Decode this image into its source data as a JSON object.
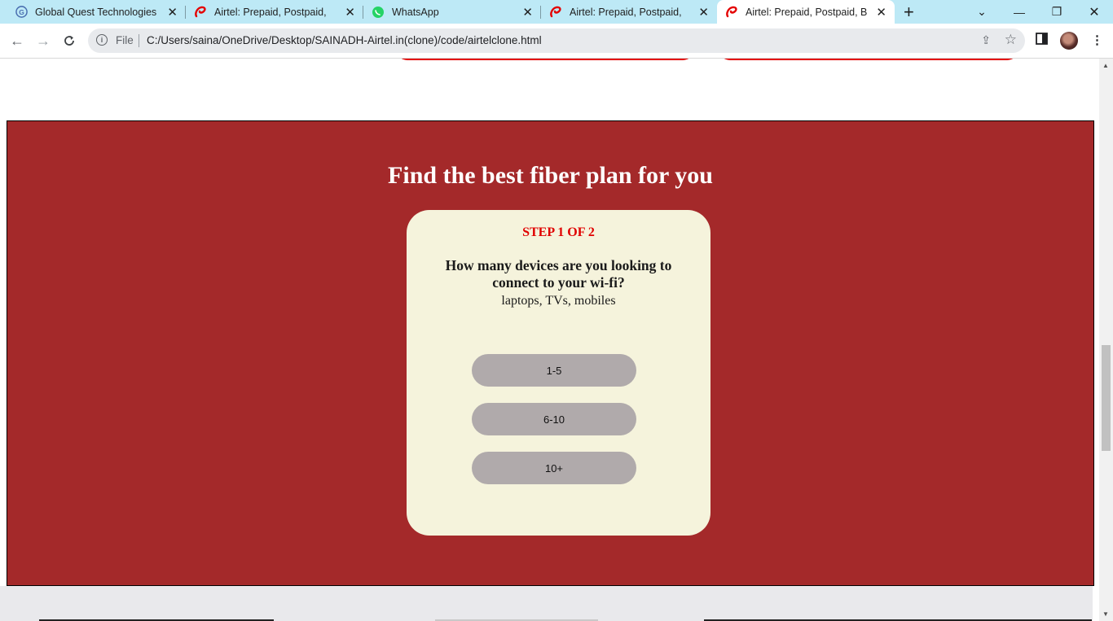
{
  "browser": {
    "tabs": [
      {
        "title": "Global Quest Technologies",
        "favicon": "globe-g-icon"
      },
      {
        "title": "Airtel: Prepaid, Postpaid, Bro",
        "favicon": "airtel-logo-icon"
      },
      {
        "title": "WhatsApp",
        "favicon": "whatsapp-icon"
      },
      {
        "title": "Airtel: Prepaid, Postpaid, Bro",
        "favicon": "airtel-logo-icon"
      },
      {
        "title": "Airtel: Prepaid, Postpaid, Bro",
        "favicon": "airtel-logo-icon",
        "active": true
      }
    ],
    "address": {
      "scheme_label": "File",
      "url": "C:/Users/saina/OneDrive/Desktop/SAINADH-Airtel.in(clone)/code/airtelclone.html"
    }
  },
  "page": {
    "heading": "Find the best fiber plan for you",
    "card": {
      "step": "STEP 1 OF 2",
      "question": "How many devices are you looking to connect to your wi-fi?",
      "hint": "laptops, TVs, mobiles",
      "options": [
        "1-5",
        "6-10",
        "10+"
      ]
    }
  },
  "colors": {
    "section_bg": "#a4292a",
    "card_bg": "#f5f3dc",
    "option_bg": "#b0aaab",
    "step_text": "#e00000",
    "tabstrip_bg": "#bde9f6"
  }
}
